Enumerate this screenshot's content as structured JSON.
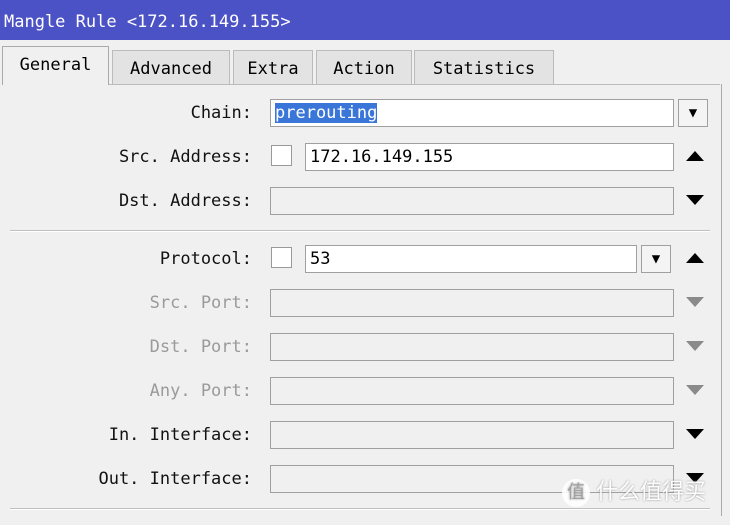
{
  "window": {
    "title": "Mangle Rule <172.16.149.155>"
  },
  "tabs": [
    {
      "label": "General"
    },
    {
      "label": "Advanced"
    },
    {
      "label": "Extra"
    },
    {
      "label": "Action"
    },
    {
      "label": "Statistics"
    }
  ],
  "form": {
    "chain": {
      "label": "Chain:",
      "value": "prerouting"
    },
    "src_address": {
      "label": "Src. Address:",
      "value": "172.16.149.155"
    },
    "dst_address": {
      "label": "Dst. Address:",
      "value": ""
    },
    "protocol": {
      "label": "Protocol:",
      "value": "53"
    },
    "src_port": {
      "label": "Src. Port:",
      "value": ""
    },
    "dst_port": {
      "label": "Dst. Port:",
      "value": ""
    },
    "any_port": {
      "label": "Any. Port:",
      "value": ""
    },
    "in_interface": {
      "label": "In. Interface:",
      "value": ""
    },
    "out_interface": {
      "label": "Out. Interface:",
      "value": ""
    }
  },
  "watermark": {
    "logo": "值",
    "text": "什么值得买"
  },
  "colors": {
    "titlebar": "#4b52c6",
    "selection": "#3a75d8"
  }
}
